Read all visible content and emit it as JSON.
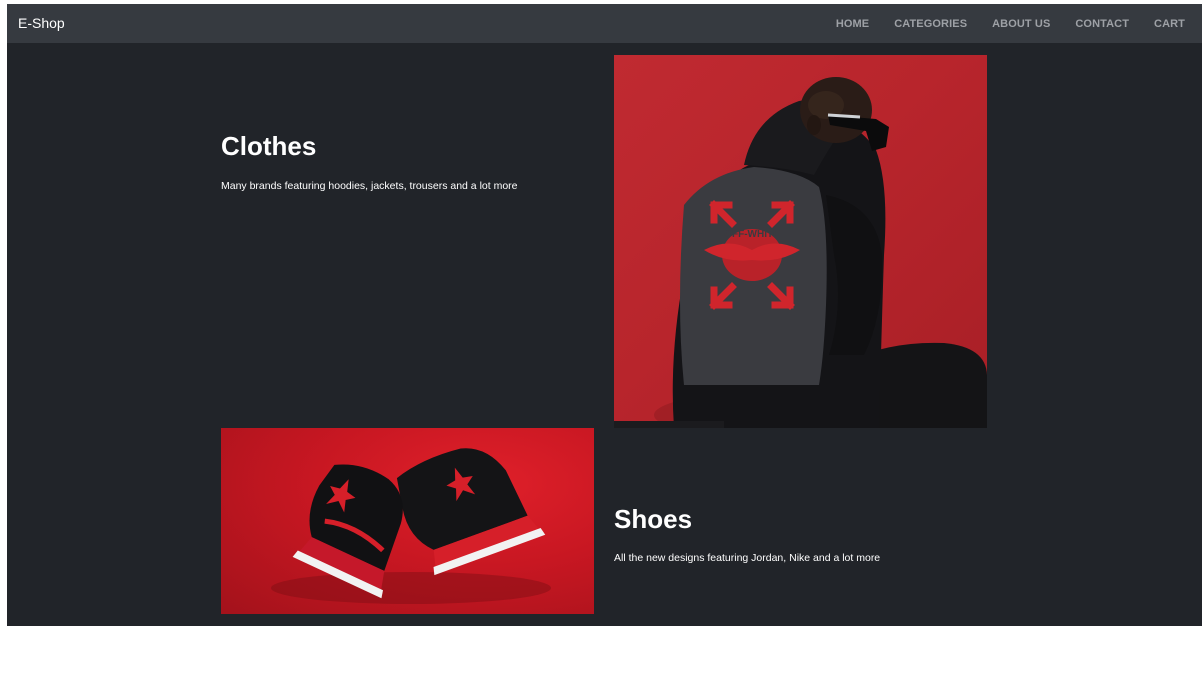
{
  "navbar": {
    "brand": "E-Shop",
    "links": [
      "HOME",
      "CATEGORIES",
      "ABOUT US",
      "CONTACT",
      "CART"
    ]
  },
  "sections": {
    "clothes": {
      "title": "Clothes",
      "description": "Many brands featuring hoodies, jackets, trousers and a lot more"
    },
    "shoes": {
      "title": "Shoes",
      "description": "All the new designs featuring Jordan, Nike and a lot more"
    }
  },
  "colors": {
    "page_background": "#212429",
    "navbar_background": "#363a40",
    "nav_link": "#9ea1a6",
    "accent_red": "#c8202a"
  }
}
